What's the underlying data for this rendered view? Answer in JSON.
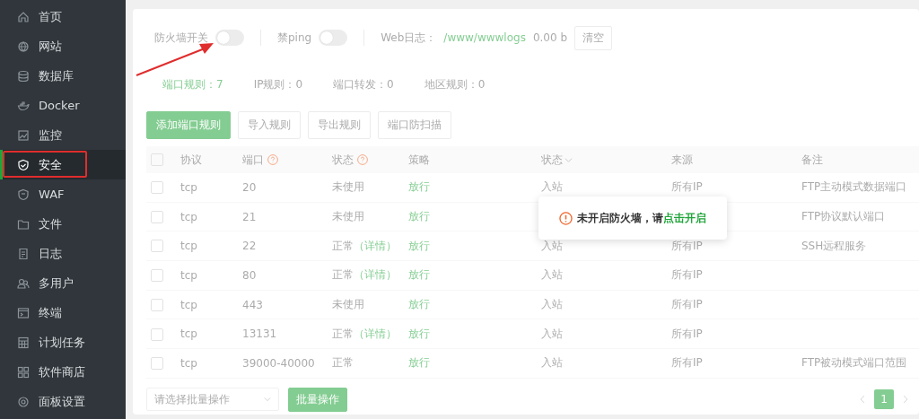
{
  "sidebar": {
    "items": [
      {
        "label": "首页",
        "selected": false,
        "highlighted": false
      },
      {
        "label": "网站",
        "selected": false,
        "highlighted": false
      },
      {
        "label": "数据库",
        "selected": false,
        "highlighted": false
      },
      {
        "label": "Docker",
        "selected": false,
        "highlighted": false
      },
      {
        "label": "监控",
        "selected": false,
        "highlighted": false
      },
      {
        "label": "安全",
        "selected": true,
        "highlighted": true
      },
      {
        "label": "WAF",
        "selected": false,
        "highlighted": false
      },
      {
        "label": "文件",
        "selected": false,
        "highlighted": false
      },
      {
        "label": "日志",
        "selected": false,
        "highlighted": false
      },
      {
        "label": "多用户",
        "selected": false,
        "highlighted": false
      },
      {
        "label": "终端",
        "selected": false,
        "highlighted": false
      },
      {
        "label": "计划任务",
        "selected": false,
        "highlighted": false
      },
      {
        "label": "软件商店",
        "selected": false,
        "highlighted": false
      },
      {
        "label": "面板设置",
        "selected": false,
        "highlighted": false
      }
    ]
  },
  "toolbar": {
    "firewall_switch": {
      "label": "防火墙开关",
      "on": false
    },
    "ping_switch": {
      "label": "禁ping",
      "on": false
    },
    "web_log": {
      "label": "Web日志：",
      "path": "/www/wwwlogs",
      "size": "0.00 b"
    },
    "clear_button": "清空"
  },
  "rule_tabs": [
    {
      "label": "端口规则：7",
      "selected": true
    },
    {
      "label": "IP规则：0",
      "selected": false
    },
    {
      "label": "端口转发：0",
      "selected": false
    },
    {
      "label": "地区规则：0",
      "selected": false
    }
  ],
  "action_buttons": [
    {
      "label": "添加端口规则",
      "primary": true
    },
    {
      "label": "导入规则",
      "primary": false
    },
    {
      "label": "导出规则",
      "primary": false
    },
    {
      "label": "端口防扫描",
      "primary": false
    }
  ],
  "table": {
    "all_checked": false,
    "columns": [
      {
        "label": "协议",
        "help": false,
        "filter": false
      },
      {
        "label": "端口",
        "help": true,
        "filter": false
      },
      {
        "label": "状态",
        "help": true,
        "filter": false
      },
      {
        "label": "策略",
        "help": false,
        "filter": false
      },
      {
        "label": "状态",
        "help": false,
        "filter": true
      },
      {
        "label": "来源",
        "help": false,
        "filter": false
      },
      {
        "label": "备注",
        "help": false,
        "filter": false
      }
    ],
    "rows": [
      {
        "checked": false,
        "protocol": "tcp",
        "port": "20",
        "status": "未使用",
        "strategy": "放行",
        "direction": "入站",
        "source": "所有IP",
        "note": "FTP主动模式数据端口"
      },
      {
        "checked": false,
        "protocol": "tcp",
        "port": "21",
        "status": "未使用",
        "strategy": "放行",
        "note": "FTP协议默认端口"
      },
      {
        "checked": false,
        "protocol": "tcp",
        "port": "22",
        "status": "正常",
        "detail": "（详情）",
        "strategy": "放行",
        "direction": "入站",
        "source": "所有IP",
        "note": "SSH远程服务"
      },
      {
        "checked": false,
        "protocol": "tcp",
        "port": "80",
        "status": "正常",
        "detail": "（详情）",
        "strategy": "放行",
        "direction": "入站",
        "source": "所有IP"
      },
      {
        "checked": false,
        "protocol": "tcp",
        "port": "443",
        "status": "未使用",
        "strategy": "放行",
        "direction": "入站",
        "source": "所有IP"
      },
      {
        "checked": false,
        "protocol": "tcp",
        "port": "13131",
        "status": "正常",
        "detail": "（详情）",
        "strategy": "放行",
        "direction": "入站",
        "source": "所有IP"
      },
      {
        "checked": false,
        "protocol": "tcp",
        "port": "39000-40000",
        "status": "正常",
        "strategy": "放行",
        "direction": "入站",
        "source": "所有IP",
        "note": "FTP被动模式端口范围"
      }
    ]
  },
  "footer": {
    "batch_select": {
      "placeholder": "请选择批量操作"
    },
    "batch_button": "批量操作",
    "pages": [
      {
        "label": "1",
        "selected": true
      }
    ]
  },
  "notice": {
    "message": "未开启防火墙，请",
    "link": "点击开启"
  }
}
